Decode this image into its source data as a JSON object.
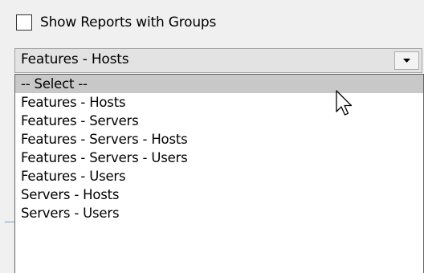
{
  "checkbox": {
    "label": "Show Reports with Groups",
    "checked": false
  },
  "dropdown": {
    "selected_value": "Features - Hosts",
    "icon": "chevron-down-icon",
    "options": [
      {
        "label": "-- Select --",
        "highlighted": true
      },
      {
        "label": "Features - Hosts",
        "highlighted": false
      },
      {
        "label": "Features - Servers",
        "highlighted": false
      },
      {
        "label": "Features - Servers - Hosts",
        "highlighted": false
      },
      {
        "label": "Features - Servers - Users",
        "highlighted": false
      },
      {
        "label": "Features - Users",
        "highlighted": false
      },
      {
        "label": "Servers - Hosts",
        "highlighted": false
      },
      {
        "label": "Servers - Users",
        "highlighted": false
      }
    ]
  },
  "colors": {
    "highlight": "#c8c8c8",
    "combo_background": "#e3e3e3",
    "window_background": "#f0f0f0"
  },
  "cursor": {
    "icon": "mouse-pointer-icon"
  }
}
